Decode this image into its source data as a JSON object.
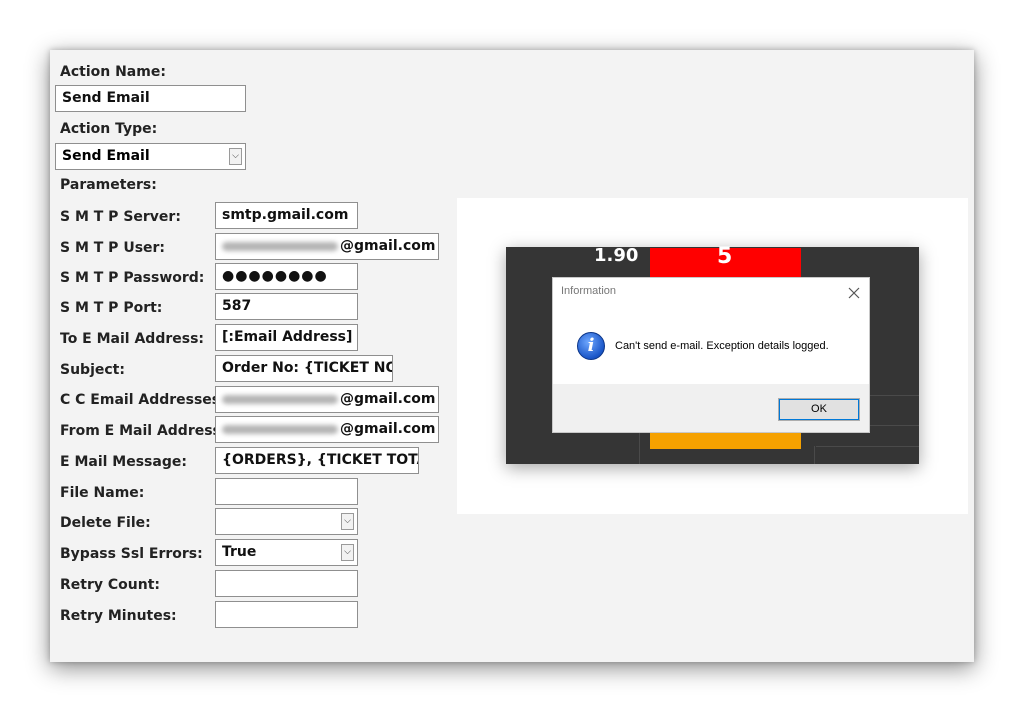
{
  "form": {
    "action_name_label": "Action Name:",
    "action_name_value": "Send Email",
    "action_type_label": "Action Type:",
    "action_type_value": "Send Email",
    "parameters_label": "Parameters:",
    "params": [
      {
        "label": "S M T P Server:",
        "value": "smtp.gmail.com",
        "kind": "text"
      },
      {
        "label": "S M T P User:",
        "value": "@gmail.com",
        "kind": "blurred"
      },
      {
        "label": "S M T P Password:",
        "value": "●●●●●●●●",
        "kind": "text"
      },
      {
        "label": "S M T P Port:",
        "value": "587",
        "kind": "text"
      },
      {
        "label": "To E Mail Address:",
        "value": "[:Email Address]",
        "kind": "text"
      },
      {
        "label": "Subject:",
        "value": "Order No: {TICKET NO}",
        "kind": "text"
      },
      {
        "label": "C C Email Addresses:",
        "value": "@gmail.com",
        "kind": "blurred"
      },
      {
        "label": "From E Mail Address:",
        "value": "@gmail.com",
        "kind": "blurred"
      },
      {
        "label": "E Mail Message:",
        "value": "{ORDERS}, {TICKET TOTAL}",
        "kind": "text"
      },
      {
        "label": "File Name:",
        "value": "",
        "kind": "text"
      },
      {
        "label": "Delete File:",
        "value": "",
        "kind": "select"
      },
      {
        "label": "Bypass Ssl Errors:",
        "value": "True",
        "kind": "select"
      },
      {
        "label": "Retry Count:",
        "value": "",
        "kind": "text"
      },
      {
        "label": "Retry Minutes:",
        "value": "",
        "kind": "text"
      }
    ]
  },
  "background_app": {
    "left_value": "1.90",
    "red_tile_value": "5",
    "colors": {
      "background": "#353535",
      "red_tile": "#ff0000",
      "orange_tile": "#f5a100"
    }
  },
  "dialog": {
    "title": "Information",
    "message": "Can't send e-mail. Exception details logged.",
    "ok_label": "OK",
    "icon": "info-icon",
    "close_icon": "close-icon"
  }
}
